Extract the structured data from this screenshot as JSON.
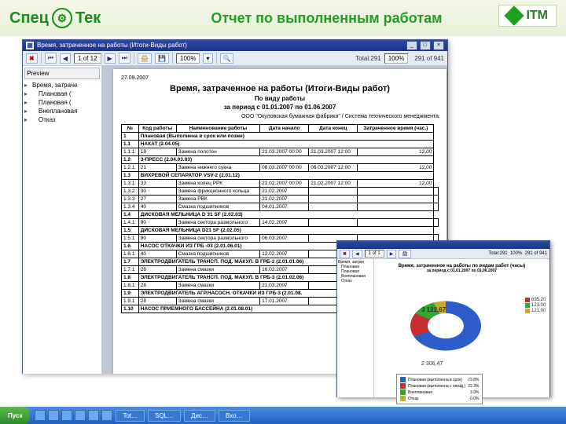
{
  "header": {
    "brand_left": "СпецТек",
    "title": "Отчет по выполненным работам",
    "brand_right": "ITM"
  },
  "report_window": {
    "title": "Время, затраченное на работы (Итоги-Виды работ)",
    "nav": {
      "page_of": "1 of 12",
      "zoom": "100%",
      "total_label": "Total:291",
      "page_count": "100%",
      "range": "291 of 941"
    },
    "tree": {
      "tab": "Preview",
      "root": "Время, затраче",
      "items": [
        "Плановая (",
        "Плановая (",
        "Внеплановая",
        "Отказ"
      ]
    },
    "paper": {
      "date": "27.09.2007",
      "title": "Время, затраченное на работы (Итоги-Виды работ)",
      "subtitle": "По виду работы",
      "period": "за период с 01.01.2007 по 01.06.2007",
      "org": "ООО \"Окуловская бумажная фабрика\" / Система технического менеджмента",
      "columns": [
        "№",
        "Код работы",
        "Наименование работы",
        "Дата начало",
        "Дата конец",
        "Затраченное время (час.)"
      ],
      "rows": [
        {
          "grp": 1,
          "cells": [
            "1",
            "Плановая (Выполнена в срок или позже)",
            "",
            "",
            "",
            ""
          ]
        },
        {
          "grp": 1,
          "cells": [
            "1.1",
            "НАКАТ (2.04.05)",
            "",
            "",
            "",
            ""
          ]
        },
        {
          "cells": [
            "1.1.1",
            "19",
            "Замена полотен",
            "21.03.2007 00:00",
            "21.03.2007 12:00",
            "12,00"
          ]
        },
        {
          "grp": 1,
          "cells": [
            "1.2",
            "3-ПРЕСС (2.04.03.03)",
            "",
            "",
            "",
            ""
          ]
        },
        {
          "cells": [
            "1.2.1",
            "21",
            "Замена нижнего сукна",
            "06.03.2007 00:00",
            "06.03.2007 12:00",
            "12,00"
          ]
        },
        {
          "grp": 1,
          "cells": [
            "1.3",
            "ВИХРЕВОЙ СЕПАРАТОР VSV-2 (2.01.12)",
            "",
            "",
            "",
            ""
          ]
        },
        {
          "cells": [
            "1.3.1",
            "33",
            "Замена колец РРК",
            "21.02.2007 00:00",
            "21.02.2007 12:00",
            "12,00"
          ]
        },
        {
          "cells": [
            "1.3.2",
            "30",
            "Замена фрикционного кольца",
            "21.02.2007",
            "",
            "",
            ""
          ]
        },
        {
          "cells": [
            "1.3.3",
            "27",
            "Замена РВК",
            "21.02.2007",
            "",
            "",
            ""
          ]
        },
        {
          "cells": [
            "1.3.4",
            "40",
            "Смазка подшипников",
            "04.01.2007",
            "",
            "",
            ""
          ]
        },
        {
          "grp": 1,
          "cells": [
            "1.4",
            "ДИСКОВАЯ МЕЛЬНИЦА D 31 SF (2.02.03)",
            "",
            "",
            "",
            ""
          ]
        },
        {
          "cells": [
            "1.4.1",
            "90",
            "Замена сектора размольного",
            "14.02.2007",
            "",
            "",
            ""
          ]
        },
        {
          "grp": 1,
          "cells": [
            "1.5",
            "ДИСКОВАЯ МЕЛЬНИЦА D21 SF (2.02.05)",
            "",
            "",
            "",
            ""
          ]
        },
        {
          "cells": [
            "1.5.1",
            "90",
            "Замена сектора размольного",
            "06.03.2007",
            "",
            "",
            ""
          ]
        },
        {
          "grp": 1,
          "cells": [
            "1.6",
            "НАСОС ОТКАЧКИ ИЗ ГРБ -03 (2.01.06.01)",
            "",
            "",
            "",
            ""
          ]
        },
        {
          "cells": [
            "1.6.1",
            "40",
            "Смазка подшипников",
            "12.02.2007",
            "",
            "",
            ""
          ]
        },
        {
          "grp": 1,
          "cells": [
            "1.7",
            "ЭЛЕКТРОДВИГАТЕЛЬ ТРАНСП. ПОД. МАКУЛ. В ГРБ-2 (2.01.01.06)",
            "",
            "",
            "",
            ""
          ]
        },
        {
          "cells": [
            "1.7.1",
            "26",
            "Замена смазки",
            "16.02.2007",
            "",
            "",
            ""
          ]
        },
        {
          "grp": 1,
          "cells": [
            "1.8",
            "ЭЛЕКТРОДВИГАТЕЛЬ ТРАНСП. ПОД. МАКУЛ. В ГРБ-3 (2.01.02.06)",
            "",
            "",
            "",
            ""
          ]
        },
        {
          "cells": [
            "1.8.1",
            "28",
            "Замена смазки",
            "21.03.2007",
            "",
            "",
            ""
          ]
        },
        {
          "grp": 1,
          "cells": [
            "1.9",
            "ЭЛЕКТРОДВИГАТЕЛЬ АГР.НАСОСН. ОТКАЧКИ ИЗ ГРБ-3 (2.01.08.",
            "",
            "",
            "",
            ""
          ]
        },
        {
          "cells": [
            "1.9.1",
            "28",
            "Замена смазки",
            "17.01.2007",
            "",
            "",
            ""
          ]
        },
        {
          "grp": 1,
          "cells": [
            "1.10",
            "НАСОС ПРИЕМНОГО БАССЕЙНА (2.01.08.01)",
            "",
            "",
            "",
            ""
          ]
        }
      ]
    }
  },
  "chart_window": {
    "title": "Время, затраченное на работы по видам работ (часы)",
    "period": "за период с 01.01.2007 по 01.06.2007",
    "total": "3 122,67",
    "bottom_value": "2 306,47",
    "callouts": [
      "695,20",
      "123,00",
      "121,00"
    ],
    "legend": [
      {
        "color": "#2e5cc8",
        "label": "Плановая (выполнена в срок)",
        "pct": "73.8%"
      },
      {
        "color": "#c82e2e",
        "label": "Плановая (выполнена с опозд.)",
        "pct": "22.3%"
      },
      {
        "color": "#2ea82e",
        "label": "Внеплановая",
        "pct": "3.9%"
      },
      {
        "color": "#c8a82e",
        "label": "Отказ",
        "pct": "0.0%"
      }
    ]
  },
  "chart_data": {
    "type": "pie",
    "title": "Время, затраченное на работы по видам работ (часы)",
    "period": "01.01.2007–01.06.2007",
    "series": [
      {
        "name": "Плановая (выполнена в срок)",
        "value": 2306.47,
        "pct": 73.8,
        "color": "#2e5cc8"
      },
      {
        "name": "Плановая (выполнена с опозданием)",
        "value": 695.2,
        "pct": 22.3,
        "color": "#c82e2e"
      },
      {
        "name": "Внеплановая",
        "value": 123.0,
        "pct": 3.9,
        "color": "#2ea82e"
      },
      {
        "name": "Отказ",
        "value": 121.0,
        "pct": 0.0,
        "color": "#c8a82e"
      }
    ],
    "total": 3122.67
  },
  "taskbar": {
    "start": "Пуск",
    "buttons": [
      "Tot…",
      "SQL…",
      "Дис…",
      "Вхо…"
    ]
  }
}
